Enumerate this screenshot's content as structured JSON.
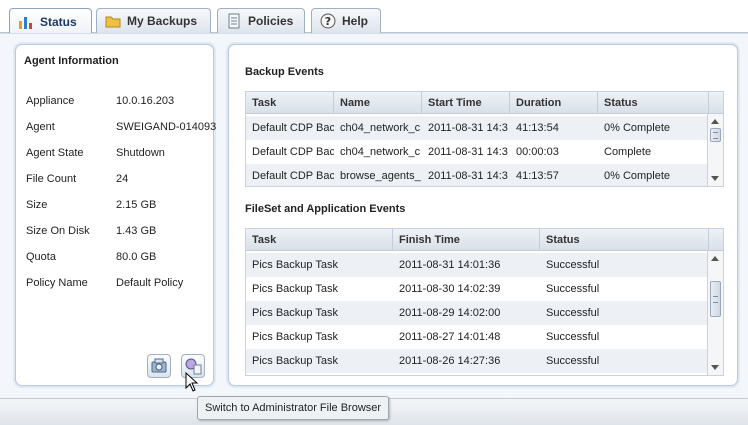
{
  "tabs": [
    {
      "label": "Status",
      "icon": "bar-chart-icon"
    },
    {
      "label": "My Backups",
      "icon": "folder-icon"
    },
    {
      "label": "Policies",
      "icon": "document-icon"
    },
    {
      "label": "Help",
      "icon": "help-icon"
    }
  ],
  "agent_info": {
    "title": "Agent Information",
    "rows": [
      {
        "key": "Appliance",
        "value": "10.0.16.203"
      },
      {
        "key": "Agent",
        "value": "SWEIGAND-014093"
      },
      {
        "key": "Agent State",
        "value": "Shutdown"
      },
      {
        "key": "File Count",
        "value": "24"
      },
      {
        "key": "Size",
        "value": "2.15 GB"
      },
      {
        "key": "Size On Disk",
        "value": "1.43 GB"
      },
      {
        "key": "Quota",
        "value": "80.0 GB"
      },
      {
        "key": "Policy Name",
        "value": "Default Policy"
      }
    ]
  },
  "backup_events": {
    "title": "Backup Events",
    "columns": [
      "Task",
      "Name",
      "Start Time",
      "Duration",
      "Status"
    ],
    "rows": [
      [
        "Default CDP Bac",
        "ch04_network_c",
        "2011-08-31 14:3",
        "41:13:54",
        "0% Complete"
      ],
      [
        "Default CDP Bac",
        "ch04_network_c",
        "2011-08-31 14:3",
        "00:00:03",
        "Complete"
      ],
      [
        "Default CDP Bac",
        "browse_agents_",
        "2011-08-31 14:3",
        "41:13:57",
        "0% Complete"
      ]
    ]
  },
  "fileset_events": {
    "title": "FileSet and Application Events",
    "columns": [
      "Task",
      "Finish Time",
      "Status"
    ],
    "rows": [
      [
        "Pics Backup Task",
        "2011-08-31 14:01:36",
        "Successful"
      ],
      [
        "Pics Backup Task",
        "2011-08-30 14:02:39",
        "Successful"
      ],
      [
        "Pics Backup Task",
        "2011-08-29 14:02:00",
        "Successful"
      ],
      [
        "Pics Backup Task",
        "2011-08-27 14:01:48",
        "Successful"
      ],
      [
        "Pics Backup Task",
        "2011-08-26 14:27:36",
        "Successful"
      ]
    ]
  },
  "tooltip": "Switch to Administrator File Browser",
  "colors": {
    "accent": "#1b3a66",
    "panel_border": "#b8c9dd",
    "row_alt": "#edf1f6"
  }
}
